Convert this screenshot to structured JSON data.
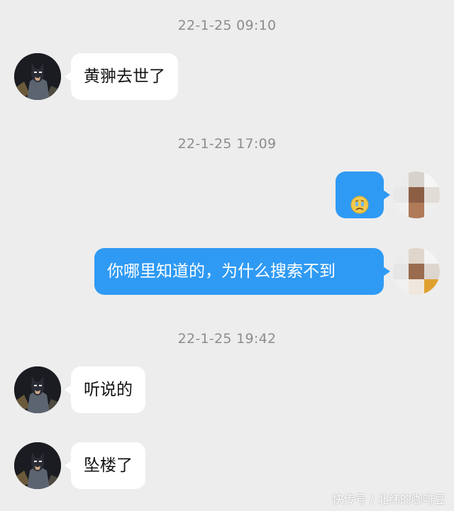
{
  "chat": {
    "messages": [
      {
        "timestamp": "22-1-25 09:10",
        "sender": "other",
        "text": "黄翀去世了"
      },
      {
        "timestamp": "22-1-25 17:09",
        "sender": "self",
        "type": "emoji",
        "emoji": "crying-face-emoji"
      },
      {
        "sender": "self",
        "text": "你哪里知道的，为什么搜索不到"
      },
      {
        "timestamp": "22-1-25 19:42",
        "sender": "other",
        "text": "听说的"
      },
      {
        "sender": "other",
        "text": "坠楼了"
      }
    ]
  },
  "watermark": "快传号 / 北纬的咖啡豆",
  "colors": {
    "background": "#ededed",
    "sent_bubble": "#2f9af4",
    "received_bubble": "#ffffff",
    "timestamp_text": "#8c8c8c"
  },
  "icons": {
    "other_avatar": "batman-avatar",
    "self_avatar": "blurred-avatar",
    "emoji": "crying-face-emoji"
  }
}
